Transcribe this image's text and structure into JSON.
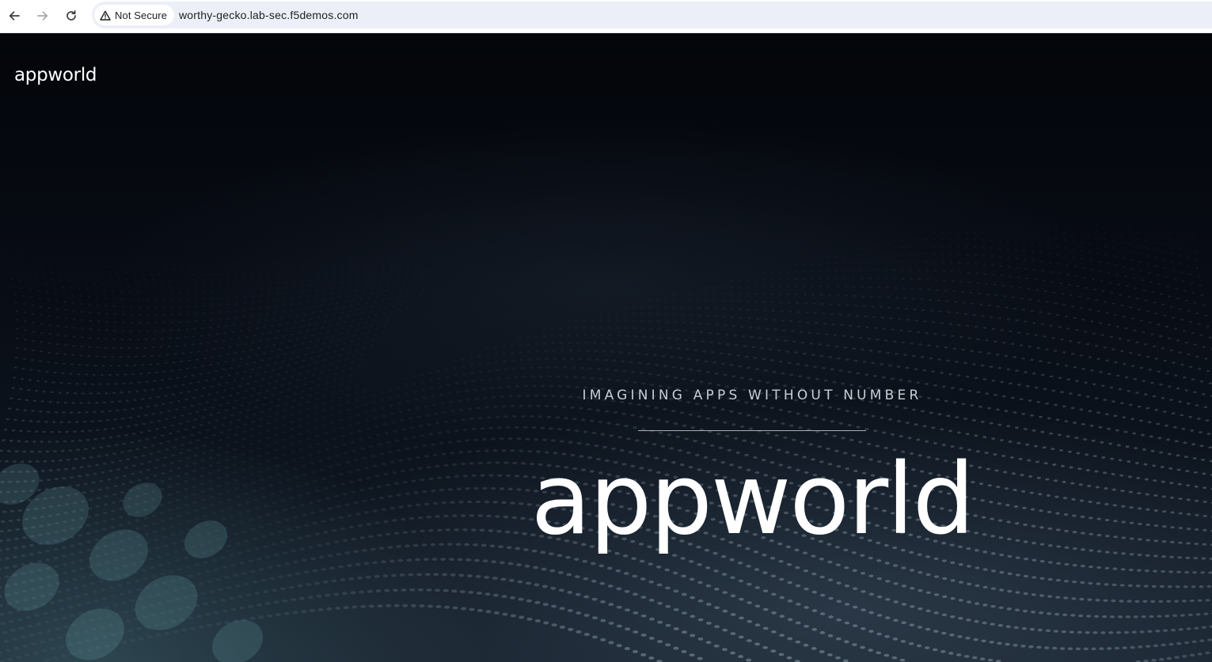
{
  "browser": {
    "security_label": "Not Secure",
    "url": "worthy-gecko.lab-sec.f5demos.com",
    "icons": {
      "back": "arrow-left-icon",
      "forward": "arrow-right-icon",
      "reload": "reload-icon",
      "security": "warning-triangle-icon"
    }
  },
  "page": {
    "brand": "appworld",
    "tagline": "IMAGINING APPS WITHOUT NUMBER",
    "title": "appworld"
  },
  "colors": {
    "background": "#05070d",
    "accent_teal": "#6fa3a8",
    "text_primary": "#ffffff",
    "text_muted": "#c9cdd3"
  }
}
